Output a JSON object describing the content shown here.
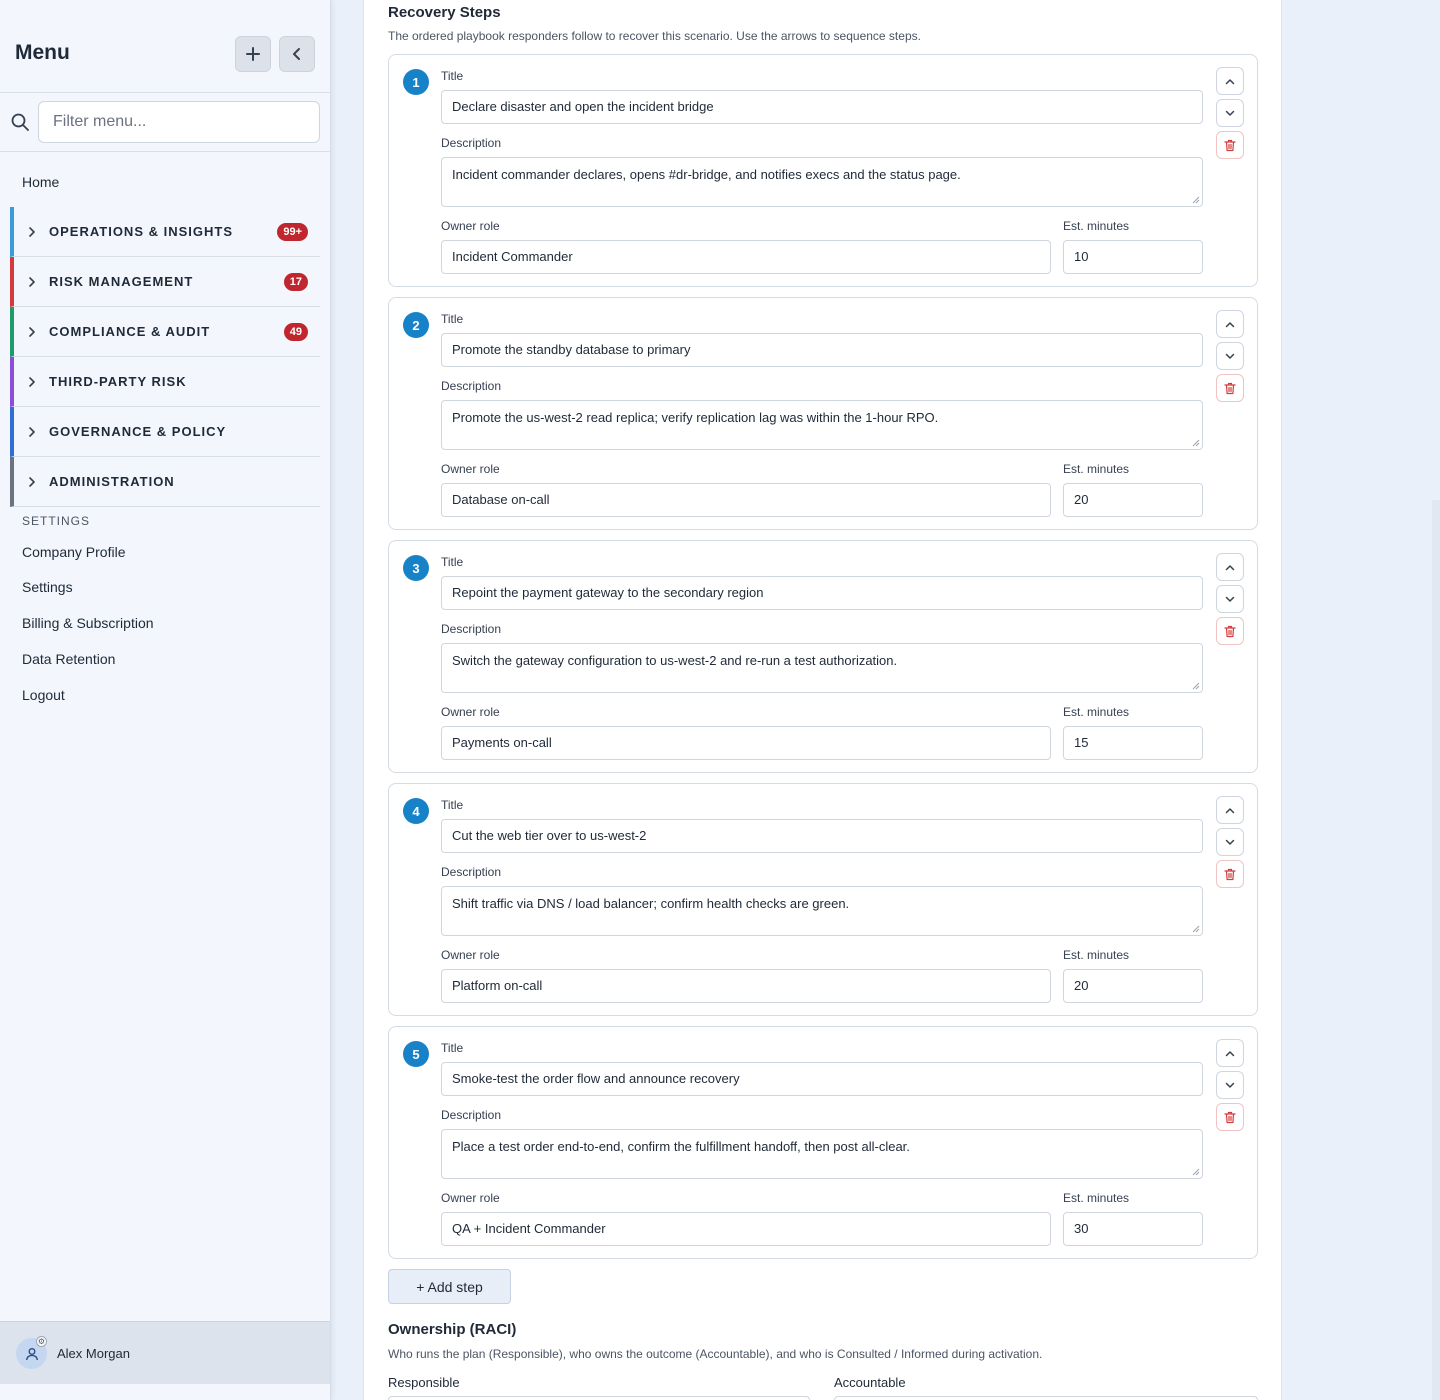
{
  "sidebar": {
    "title": "Menu",
    "add_icon": "plus-icon",
    "collapse_icon": "chevron-left-icon",
    "filter_placeholder": "Filter menu...",
    "home": "Home",
    "groups": [
      {
        "label": "OPERATIONS & INSIGHTS",
        "badge": "99+",
        "accent": "#3b9ad9"
      },
      {
        "label": "RISK MANAGEMENT",
        "badge": "17",
        "accent": "#d33a3a"
      },
      {
        "label": "COMPLIANCE & AUDIT",
        "badge": "49",
        "accent": "#1f9a6a"
      },
      {
        "label": "THIRD-PARTY RISK",
        "badge": "",
        "accent": "#8a4fd6"
      },
      {
        "label": "GOVERNANCE & POLICY",
        "badge": "",
        "accent": "#2f6fd1"
      },
      {
        "label": "ADMINISTRATION",
        "badge": "",
        "accent": "#6b7280"
      }
    ],
    "settings_heading": "SETTINGS",
    "links": [
      "Company Profile",
      "Settings",
      "Billing & Subscription",
      "Data Retention",
      "Logout"
    ],
    "user": {
      "name": "Alex Morgan"
    }
  },
  "recovery": {
    "title": "Recovery Steps",
    "description": "The ordered playbook responders follow to recover this scenario. Use the arrows to sequence steps.",
    "labels": {
      "title": "Title",
      "description": "Description",
      "owner": "Owner role",
      "minutes": "Est. minutes"
    },
    "steps": [
      {
        "num": "1",
        "title": "Declare disaster and open the incident bridge",
        "description": "Incident commander declares, opens #dr-bridge, and notifies execs and the status page.",
        "owner": "Incident Commander",
        "minutes": "10"
      },
      {
        "num": "2",
        "title": "Promote the standby database to primary",
        "description": "Promote the us-west-2 read replica; verify replication lag was within the 1-hour RPO.",
        "owner": "Database on-call",
        "minutes": "20"
      },
      {
        "num": "3",
        "title": "Repoint the payment gateway to the secondary region",
        "description": "Switch the gateway configuration to us-west-2 and re-run a test authorization.",
        "owner": "Payments on-call",
        "minutes": "15"
      },
      {
        "num": "4",
        "title": "Cut the web tier over to us-west-2",
        "description": "Shift traffic via DNS / load balancer; confirm health checks are green.",
        "owner": "Platform on-call",
        "minutes": "20"
      },
      {
        "num": "5",
        "title": "Smoke-test the order flow and announce recovery",
        "description": "Place a test order end-to-end, confirm the fulfillment handoff, then post all-clear.",
        "owner": "QA + Incident Commander",
        "minutes": "30"
      }
    ],
    "add_step_label": "+ Add step"
  },
  "raci": {
    "title": "Ownership (RACI)",
    "description": "Who runs the plan (Responsible), who owns the outcome (Accountable), and who is Consulted / Informed during activation.",
    "responsible_label": "Responsible",
    "accountable_label": "Accountable"
  },
  "colors": {
    "step_badge": "#1782c8",
    "danger": "#d33a3a",
    "count_badge": "#c0262d"
  }
}
